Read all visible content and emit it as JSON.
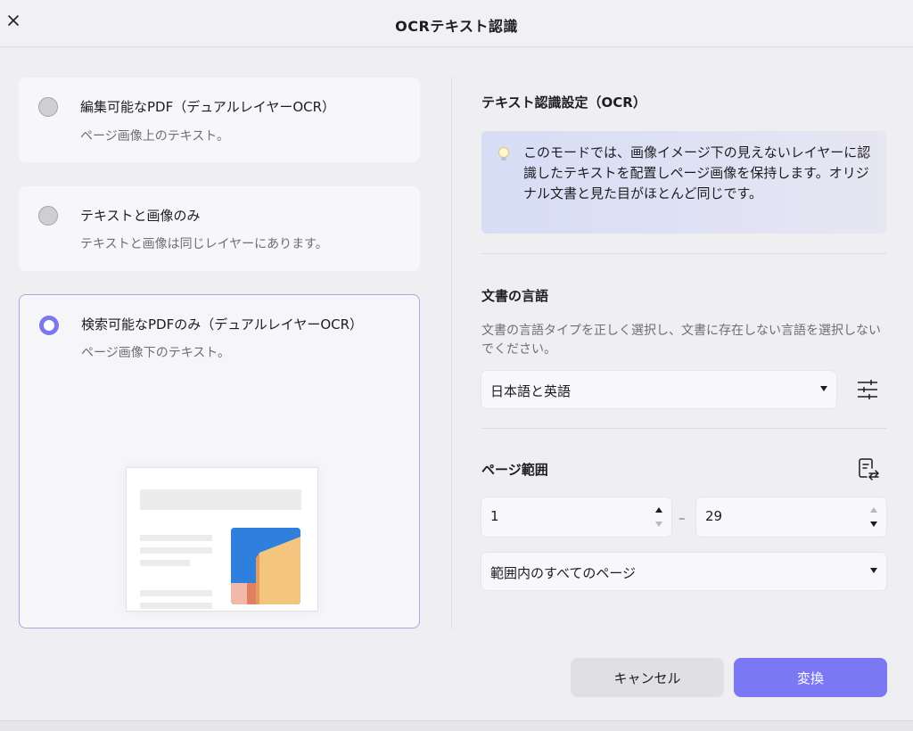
{
  "dialog": {
    "title": "OCRテキスト認識",
    "close_icon": "close-icon"
  },
  "options": [
    {
      "title": "編集可能なPDF（デュアルレイヤーOCR）",
      "subtitle": "ページ画像上のテキスト。",
      "selected": false
    },
    {
      "title": "テキストと画像のみ",
      "subtitle": "テキストと画像は同じレイヤーにあります。",
      "selected": false
    },
    {
      "title": "検索可能なPDFのみ（デュアルレイヤーOCR）",
      "subtitle": "ページ画像下のテキスト。",
      "selected": true
    }
  ],
  "settings": {
    "title": "テキスト認識設定（OCR）",
    "info": "このモードでは、画像イメージ下の見えないレイヤーに認識したテキストを配置しページ画像を保持します。オリジナル文書と見た目がほとんど同じです。",
    "info_icon": "lightbulb-icon"
  },
  "language": {
    "title": "文書の言語",
    "description": "文書の言語タイプを正しく選択し、文書に存在しない言語を選択しないでください。",
    "selected": "日本語と英語",
    "settings_icon": "sliders-icon"
  },
  "page_range": {
    "title": "ページ範囲",
    "icon": "page-range-icon",
    "from": "1",
    "separator": "–",
    "to": "29",
    "scope": "範囲内のすべてのページ"
  },
  "buttons": {
    "cancel": "キャンセル",
    "convert": "変換"
  },
  "colors": {
    "accent": "#7c78f4",
    "background": "#efeff1"
  }
}
